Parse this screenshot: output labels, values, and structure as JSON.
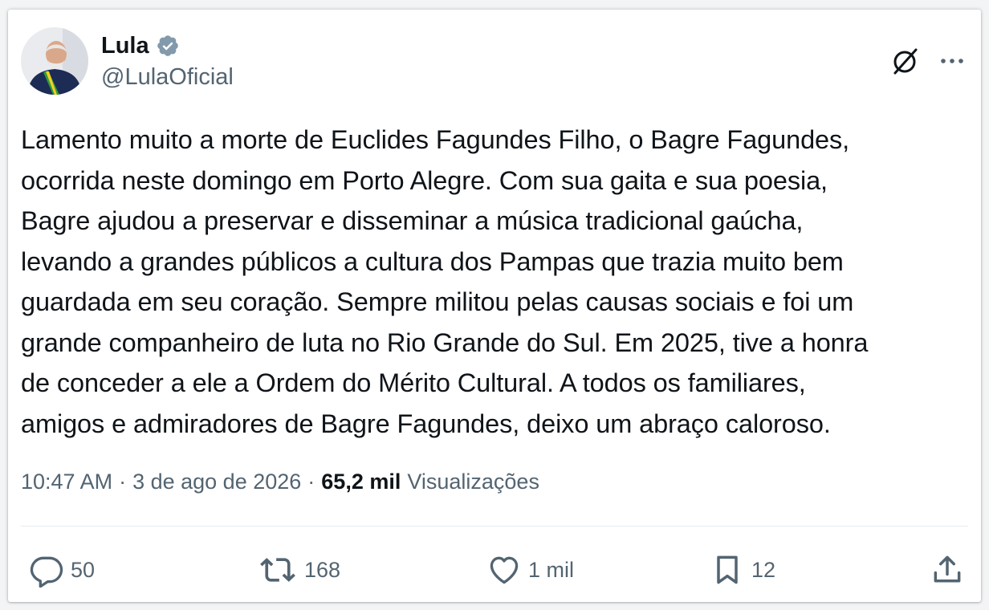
{
  "tweet": {
    "author": {
      "display_name": "Lula",
      "handle": "@LulaOficial",
      "verified": true
    },
    "text": "Lamento muito a morte de Euclides Fagundes Filho, o Bagre Fagundes,\nocorrida neste domingo em Porto Alegre. Com sua gaita e sua poesia,\nBagre ajudou a preservar e disseminar a música tradicional gaúcha,\nlevando a grandes públicos a cultura dos Pampas que trazia muito bem\nguardada em seu coração. Sempre militou pelas causas sociais e foi um\ngrande companheiro de luta no Rio Grande do Sul. Em 2025, tive a honra\nde conceder a ele a Ordem do Mérito Cultural. A todos os familiares,\namigos e admiradores de Bagre Fagundes, deixo um abraço caloroso.",
    "time": "10:47 AM",
    "separator": "·",
    "date": "3 de ago de 2026",
    "views_count": "65,2 mil",
    "views_label": "Visualizações",
    "actions": {
      "replies": "50",
      "reposts": "168",
      "likes": "1 mil",
      "bookmarks": "12"
    }
  },
  "icons": {
    "verified": "verified-badge-icon",
    "grok": "grok-icon",
    "more": "more-icon",
    "reply": "reply-icon",
    "repost": "repost-icon",
    "like": "like-icon",
    "bookmark": "bookmark-icon",
    "share": "share-icon"
  },
  "colors": {
    "text_primary": "#0f1419",
    "text_secondary": "#536471",
    "verified_badge": "#829aab",
    "divider": "#e6ecf0"
  }
}
